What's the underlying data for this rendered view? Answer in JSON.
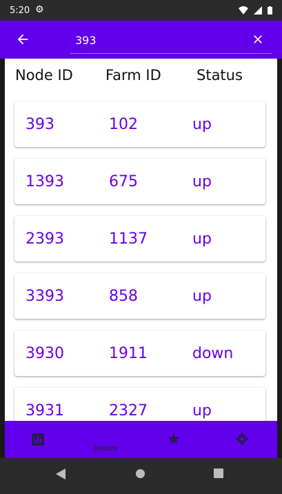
{
  "status_bar": {
    "time": "5:20"
  },
  "search": {
    "query": "393"
  },
  "table": {
    "headers": [
      "Node ID",
      "Farm ID",
      "Status"
    ],
    "rows": [
      {
        "node_id": "393",
        "farm_id": "102",
        "status": "up"
      },
      {
        "node_id": "1393",
        "farm_id": "675",
        "status": "up"
      },
      {
        "node_id": "2393",
        "farm_id": "1137",
        "status": "up"
      },
      {
        "node_id": "3393",
        "farm_id": "858",
        "status": "up"
      },
      {
        "node_id": "3930",
        "farm_id": "1911",
        "status": "down"
      },
      {
        "node_id": "3931",
        "farm_id": "2327",
        "status": "up"
      }
    ]
  },
  "bottom_nav": {
    "active_label": "Nodes"
  },
  "colors": {
    "primary": "#6200ee",
    "accent_text": "#6a00e6"
  }
}
